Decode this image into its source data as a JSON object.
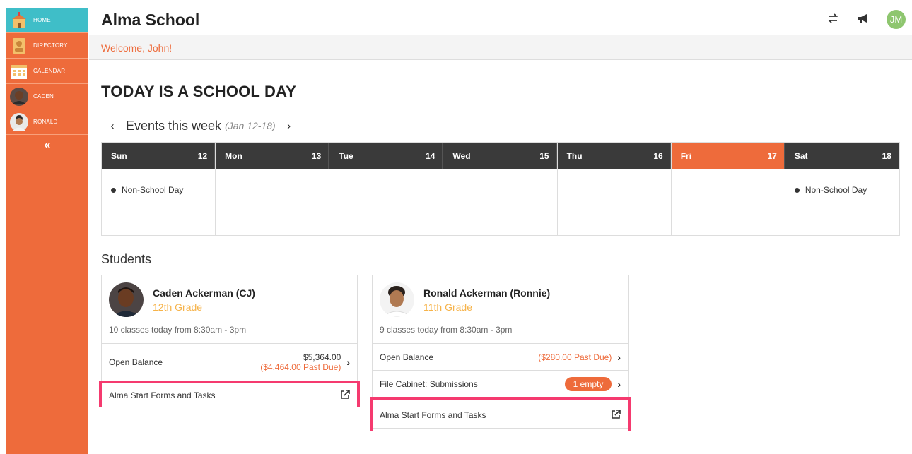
{
  "sidebar": {
    "items": [
      {
        "label": "HOME",
        "icon": "school-icon",
        "active": true
      },
      {
        "label": "DIRECTORY",
        "icon": "directory-icon",
        "active": false
      },
      {
        "label": "CALENDAR",
        "icon": "calendar-icon",
        "active": false
      },
      {
        "label": "CADEN",
        "icon": "student-avatar-icon",
        "active": false
      },
      {
        "label": "RONALD",
        "icon": "student-avatar-icon",
        "active": false
      }
    ],
    "collapse": "«"
  },
  "header": {
    "title": "Alma School",
    "avatar_initials": "JM"
  },
  "welcome": "Welcome, John!",
  "status_heading": "TODAY IS A SCHOOL DAY",
  "events": {
    "title": "Events this week",
    "range": "(Jan 12-18)",
    "prev": "‹",
    "next": "›"
  },
  "calendar": {
    "days": [
      {
        "name": "Sun",
        "date": "12",
        "event": "Non-School Day",
        "today": false
      },
      {
        "name": "Mon",
        "date": "13",
        "event": "",
        "today": false
      },
      {
        "name": "Tue",
        "date": "14",
        "event": "",
        "today": false
      },
      {
        "name": "Wed",
        "date": "15",
        "event": "",
        "today": false
      },
      {
        "name": "Thu",
        "date": "16",
        "event": "",
        "today": false
      },
      {
        "name": "Fri",
        "date": "17",
        "event": "",
        "today": true
      },
      {
        "name": "Sat",
        "date": "18",
        "event": "Non-School Day",
        "today": false
      }
    ]
  },
  "students_title": "Students",
  "students": [
    {
      "name": "Caden Ackerman (CJ)",
      "grade": "12th Grade",
      "classes": "10 classes today from 8:30am - 3pm",
      "balance_label": "Open Balance",
      "balance_amount": "$5,364.00",
      "balance_past_due": "($4,464.00 Past Due)",
      "forms_label": "Alma Start Forms and Tasks"
    },
    {
      "name": "Ronald Ackerman (Ronnie)",
      "grade": "11th Grade",
      "classes": "9 classes today from 8:30am - 3pm",
      "balance_label": "Open Balance",
      "balance_past_due": "($280.00 Past Due)",
      "file_cabinet_label": "File Cabinet: Submissions",
      "file_cabinet_badge": "1 empty",
      "forms_label": "Alma Start Forms and Tasks"
    }
  ],
  "colors": {
    "brand": "#ee6b3b",
    "active_nav": "#3fbec8",
    "grade": "#f6b34a",
    "highlight": "#f53a6f",
    "calendar_header": "#3a3a3a"
  }
}
